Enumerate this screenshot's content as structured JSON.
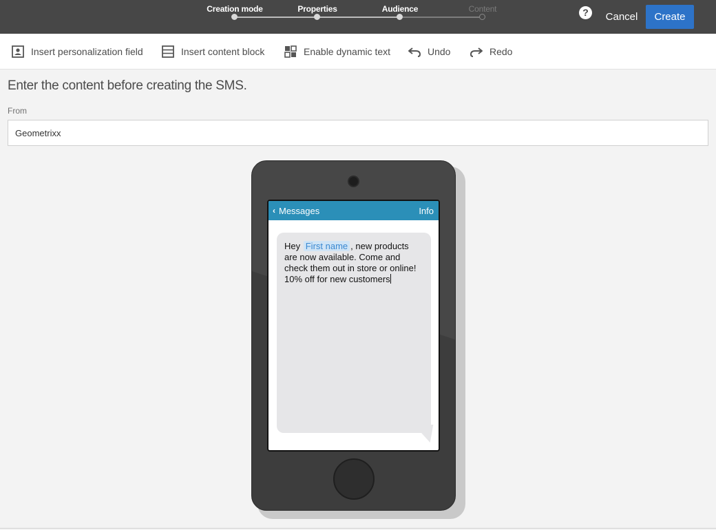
{
  "wizard": {
    "steps": [
      {
        "label": "Creation mode",
        "state": "done"
      },
      {
        "label": "Properties",
        "state": "done"
      },
      {
        "label": "Audience",
        "state": "done"
      },
      {
        "label": "Content",
        "state": "current"
      }
    ],
    "help_label": "?",
    "cancel_label": "Cancel",
    "create_label": "Create"
  },
  "toolbar": {
    "insert_field_label": "Insert personalization field",
    "insert_block_label": "Insert content block",
    "dynamic_text_label": "Enable dynamic text",
    "undo_label": "Undo",
    "redo_label": "Redo"
  },
  "content": {
    "title": "Enter the content before creating the SMS.",
    "from_label": "From",
    "from_value": "Geometrixx"
  },
  "phone": {
    "back_label": "Messages",
    "info_label": "Info",
    "message": {
      "prefix": "Hey ",
      "field": "First name",
      "suffix": ", new products are now available. Come and check them out in store or online! 10% off for new customers"
    }
  },
  "colors": {
    "topbar": "#474747",
    "accent": "#2d73c8",
    "phone_header": "#2b8fb8",
    "bubble": "#e6e6e8",
    "personalization_field": "#3a88d1"
  }
}
